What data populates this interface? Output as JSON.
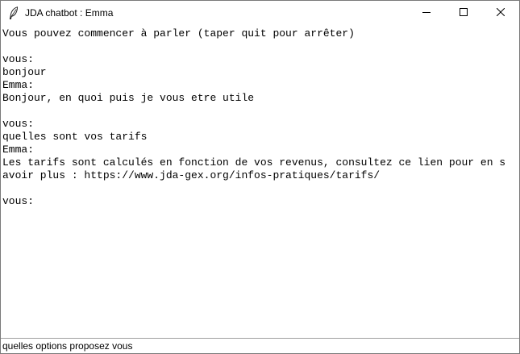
{
  "window": {
    "title": "JDA chatbot : Emma",
    "icon": "feather-icon",
    "controls": [
      "minimize-icon",
      "maximize-icon",
      "close-icon"
    ]
  },
  "chat": {
    "lines": [
      "Vous pouvez commencer à parler (taper quit pour arrêter)",
      "",
      "vous:",
      "bonjour",
      "Emma:",
      "Bonjour, en quoi puis je vous etre utile",
      "",
      "vous:",
      "quelles sont vos tarifs",
      "Emma:",
      "Les tarifs sont calculés en fonction de vos revenus, consultez ce lien pour en s",
      "avoir plus : https://www.jda-gex.org/infos-pratiques/tarifs/",
      "",
      "vous:"
    ]
  },
  "input": {
    "value": "quelles options proposez vous"
  },
  "colors": {
    "background": "#ffffff",
    "text": "#000000",
    "border": "#a0a0a0"
  }
}
